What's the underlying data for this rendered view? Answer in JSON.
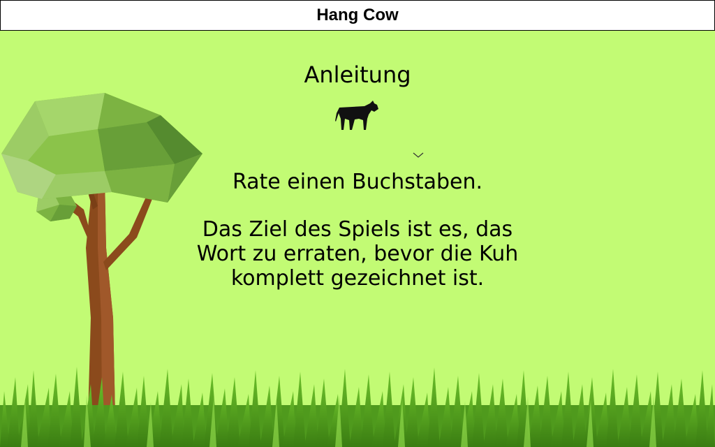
{
  "app": {
    "title": "Hang Cow"
  },
  "instructions": {
    "heading": "Anleitung",
    "step": "Rate einen Buchstaben.",
    "goal_line1": "Das Ziel des Spiels ist es, das",
    "goal_line2": "Wort zu erraten, bevor die Kuh",
    "goal_line3": "komplett gezeichnet ist."
  },
  "icons": {
    "cow": "cow-icon",
    "expand": "chevron-down-icon"
  },
  "colors": {
    "background": "#c2fb74",
    "title_bar": "#ffffff",
    "text": "#000000",
    "tree_foliage": "#8bc34a",
    "tree_trunk": "#8b4a1c",
    "grass": "#4f9a1d"
  }
}
